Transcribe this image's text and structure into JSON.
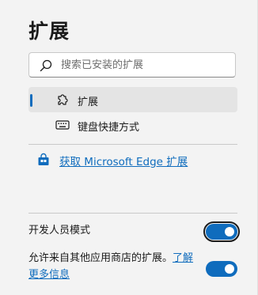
{
  "header": {
    "title": "扩展"
  },
  "search": {
    "placeholder": "搜索已安装的扩展",
    "value": "",
    "icon": "search-icon"
  },
  "nav": {
    "items": [
      {
        "label": "扩展",
        "icon": "puzzle-icon",
        "active": true
      },
      {
        "label": "键盘快捷方式",
        "icon": "keyboard-icon",
        "active": false
      }
    ]
  },
  "store_link": {
    "label": "获取 Microsoft Edge 扩展",
    "icon": "shopping-bag-icon"
  },
  "settings": {
    "developer_mode": {
      "label": "开发人员模式",
      "enabled": true
    },
    "other_stores": {
      "label": "允许来自其他应用商店的扩展。",
      "link_label": "了解更多信息",
      "enabled": true
    }
  },
  "colors": {
    "accent": "#0f6cbd",
    "background": "#f3f3f3",
    "active_item": "#e4e4e4"
  }
}
